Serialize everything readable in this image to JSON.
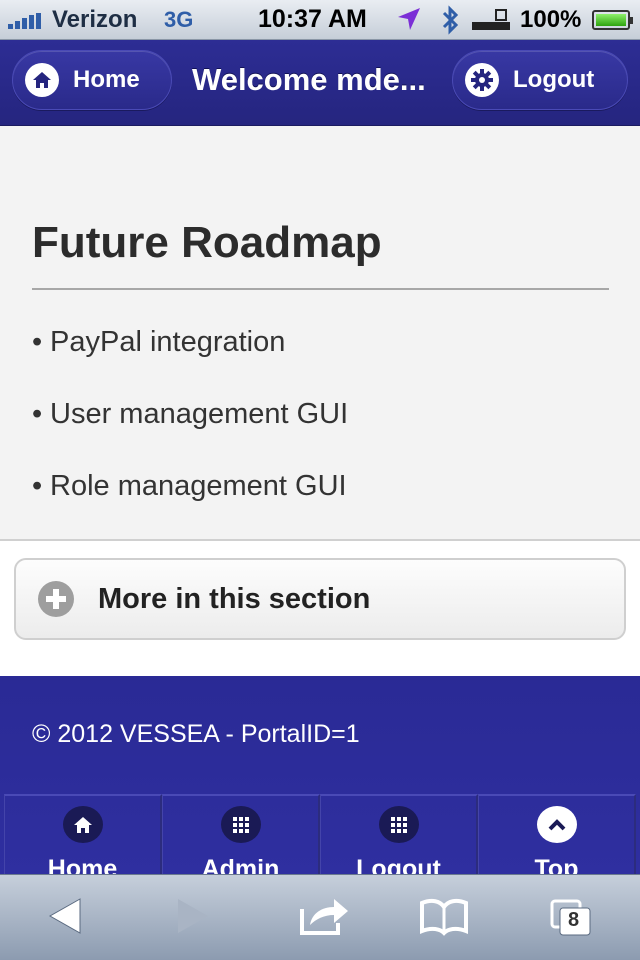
{
  "status_bar": {
    "carrier": "Verizon",
    "network": "3G",
    "time": "10:37 AM",
    "battery": "100%",
    "battery_level": 1.0
  },
  "header": {
    "home_label": "Home",
    "title": "Welcome mde...",
    "logout_label": "Logout"
  },
  "main": {
    "heading": "Future Roadmap",
    "items": [
      "PayPal integration",
      "User management GUI",
      "Role management GUI"
    ],
    "bullet": "•"
  },
  "more_section": {
    "label": "More in this section"
  },
  "footer": {
    "copyright": "© 2012 VESSEA - PortalID=1",
    "nav": [
      {
        "label": "Home",
        "icon": "home-icon"
      },
      {
        "label": "Admin",
        "icon": "grid-icon"
      },
      {
        "label": "Logout",
        "icon": "grid-icon"
      },
      {
        "label": "Top",
        "icon": "chevron-up-icon"
      }
    ]
  },
  "safari_toolbar": {
    "tab_count": "8"
  },
  "colors": {
    "header_bg": "#2d2d94",
    "footer_bg": "#2f2fa0",
    "content_bg": "#f3f3f3"
  }
}
